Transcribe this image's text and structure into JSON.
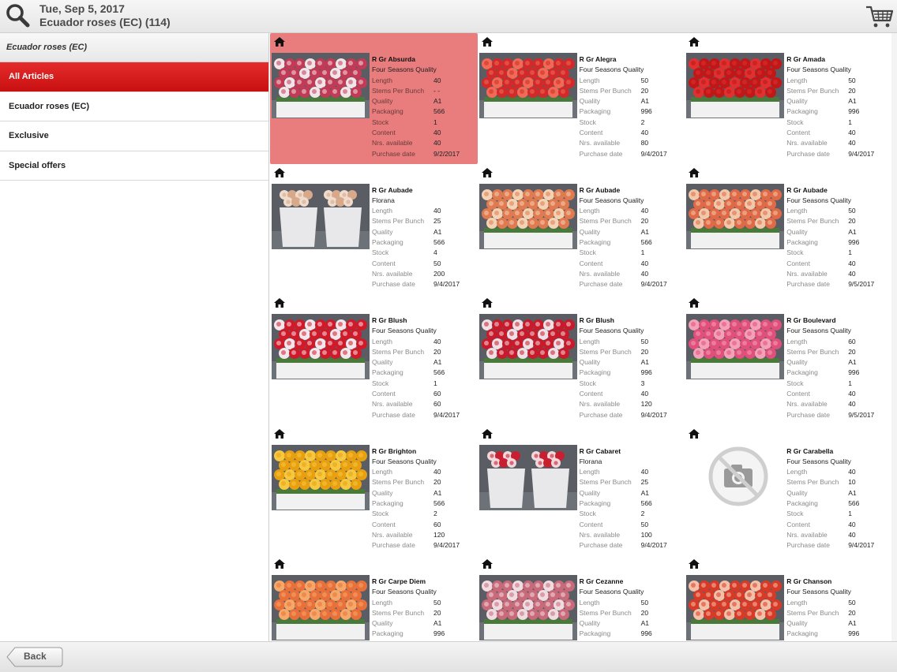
{
  "header": {
    "date": "Tue, Sep 5, 2017",
    "title": "Ecuador roses (EC) (114)",
    "search_icon": "search-icon",
    "cart_icon": "cart-icon"
  },
  "sidebar": {
    "heading": "Ecuador roses (EC)",
    "items": [
      {
        "label": "All Articles",
        "active": true
      },
      {
        "label": "Ecuador roses (EC)",
        "active": false
      },
      {
        "label": "Exclusive",
        "active": false
      },
      {
        "label": "Special offers",
        "active": false
      }
    ]
  },
  "field_labels": {
    "length": "Length",
    "stems_per_bunch": "Stems Per Bunch",
    "quality": "Quality",
    "packaging": "Packaging",
    "stock": "Stock",
    "content": "Content",
    "nrs_available": "Nrs. available",
    "purchase_date": "Purchase date"
  },
  "products": [
    {
      "name": "R Gr Absurda",
      "sub": "Four Seasons Quality",
      "length": "40",
      "stems_per_bunch": "- -",
      "quality": "A1",
      "packaging": "566",
      "stock": "1",
      "content": "40",
      "nrs_available": "40",
      "purchase_date": "9/2/2017",
      "selected": true,
      "photo": "flowers",
      "colors": [
        "#c23a55",
        "#f2e4e8"
      ]
    },
    {
      "name": "R Gr Alegra",
      "sub": "Four Seasons Quality",
      "length": "50",
      "stems_per_bunch": "20",
      "quality": "A1",
      "packaging": "996",
      "stock": "2",
      "content": "40",
      "nrs_available": "80",
      "purchase_date": "9/4/2017",
      "photo": "flowers",
      "colors": [
        "#d22a2a",
        "#f06a55"
      ]
    },
    {
      "name": "R Gr Amada",
      "sub": "Four Seasons Quality",
      "length": "50",
      "stems_per_bunch": "20",
      "quality": "A1",
      "packaging": "996",
      "stock": "1",
      "content": "40",
      "nrs_available": "40",
      "purchase_date": "9/4/2017",
      "photo": "flowers",
      "colors": [
        "#c01818",
        "#e03030"
      ]
    },
    {
      "name": "R Gr Aubade",
      "sub": "Florana",
      "length": "40",
      "stems_per_bunch": "25",
      "quality": "A1",
      "packaging": "566",
      "stock": "4",
      "content": "50",
      "nrs_available": "200",
      "purchase_date": "9/4/2017",
      "photo": "wrapped",
      "colors": [
        "#d8a98a",
        "#f0dccd"
      ]
    },
    {
      "name": "R Gr Aubade",
      "sub": "Four Seasons Quality",
      "length": "40",
      "stems_per_bunch": "20",
      "quality": "A1",
      "packaging": "566",
      "stock": "1",
      "content": "40",
      "nrs_available": "40",
      "purchase_date": "9/4/2017",
      "photo": "flowers",
      "colors": [
        "#e07a50",
        "#f4d2b4"
      ]
    },
    {
      "name": "R Gr Aubade",
      "sub": "Four Seasons Quality",
      "length": "50",
      "stems_per_bunch": "20",
      "quality": "A1",
      "packaging": "996",
      "stock": "1",
      "content": "40",
      "nrs_available": "40",
      "purchase_date": "9/5/2017",
      "photo": "flowers",
      "colors": [
        "#e06a48",
        "#f2c8a8"
      ]
    },
    {
      "name": "R Gr Blush",
      "sub": "Four Seasons Quality",
      "length": "40",
      "stems_per_bunch": "20",
      "quality": "A1",
      "packaging": "566",
      "stock": "1",
      "content": "60",
      "nrs_available": "60",
      "purchase_date": "9/4/2017",
      "photo": "flowers",
      "colors": [
        "#d01a2a",
        "#f4e6ea"
      ]
    },
    {
      "name": "R Gr Blush",
      "sub": "Four Seasons Quality",
      "length": "50",
      "stems_per_bunch": "20",
      "quality": "A1",
      "packaging": "996",
      "stock": "3",
      "content": "40",
      "nrs_available": "120",
      "purchase_date": "9/4/2017",
      "photo": "flowers",
      "colors": [
        "#c81a2a",
        "#f0dfe4"
      ]
    },
    {
      "name": "R Gr Boulevard",
      "sub": "Four Seasons Quality",
      "length": "60",
      "stems_per_bunch": "20",
      "quality": "A1",
      "packaging": "996",
      "stock": "1",
      "content": "40",
      "nrs_available": "40",
      "purchase_date": "9/5/2017",
      "photo": "flowers",
      "colors": [
        "#e0507a",
        "#f4a0b8"
      ]
    },
    {
      "name": "R Gr Brighton",
      "sub": "Four Seasons Quality",
      "length": "40",
      "stems_per_bunch": "20",
      "quality": "A1",
      "packaging": "566",
      "stock": "2",
      "content": "60",
      "nrs_available": "120",
      "purchase_date": "9/4/2017",
      "photo": "flowers",
      "colors": [
        "#e8a010",
        "#f6c840"
      ]
    },
    {
      "name": "R Gr Cabaret",
      "sub": "Florana",
      "length": "40",
      "stems_per_bunch": "25",
      "quality": "A1",
      "packaging": "566",
      "stock": "2",
      "content": "50",
      "nrs_available": "100",
      "purchase_date": "9/4/2017",
      "photo": "wrapped",
      "colors": [
        "#c82030",
        "#f2d8dc"
      ]
    },
    {
      "name": "R Gr Carabella",
      "sub": "Four Seasons Quality",
      "length": "40",
      "stems_per_bunch": "10",
      "quality": "A1",
      "packaging": "566",
      "stock": "1",
      "content": "40",
      "nrs_available": "40",
      "purchase_date": "9/4/2017",
      "photo": "none",
      "colors": [
        "#bbbbbb",
        "#dddddd"
      ]
    },
    {
      "name": "R Gr Carpe Diem",
      "sub": "Four Seasons Quality",
      "length": "50",
      "stems_per_bunch": "20",
      "quality": "A1",
      "packaging": "996",
      "photo": "flowers",
      "colors": [
        "#e8703a",
        "#f6a868"
      ]
    },
    {
      "name": "R Gr Cezanne",
      "sub": "Four Seasons Quality",
      "length": "50",
      "stems_per_bunch": "20",
      "quality": "A1",
      "packaging": "996",
      "photo": "flowers",
      "colors": [
        "#c86a7a",
        "#f0dce0"
      ]
    },
    {
      "name": "R Gr Chanson",
      "sub": "Four Seasons Quality",
      "length": "50",
      "stems_per_bunch": "20",
      "quality": "A1",
      "packaging": "996",
      "photo": "flowers",
      "colors": [
        "#d83a28",
        "#f4c0a8"
      ]
    }
  ],
  "footer": {
    "back_label": "Back"
  }
}
